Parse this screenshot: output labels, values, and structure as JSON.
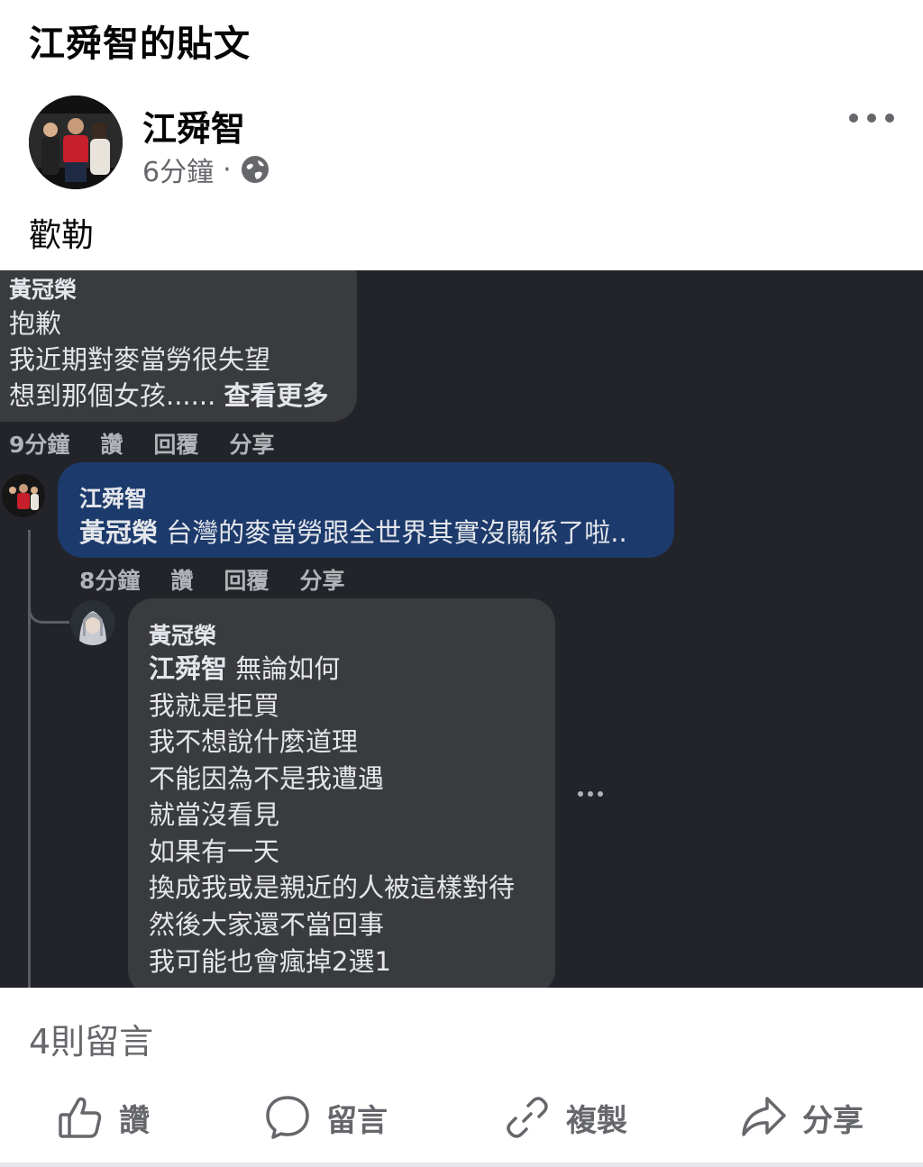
{
  "page": {
    "title": "江舜智的貼文"
  },
  "post": {
    "author": "江舜智",
    "time": "6分鐘",
    "separator": "·",
    "audience_icon": "globe-icon",
    "more_icon": "more-dots-icon",
    "text": "歡勒"
  },
  "screenshot": {
    "comment1": {
      "author": "黃冠榮",
      "lines": [
        "抱歉",
        "我近期對麥當勞很失望"
      ],
      "last_line": "想到那個女孩......",
      "see_more": "查看更多",
      "time": "9分鐘",
      "like": "讚",
      "reply": "回覆",
      "share": "分享"
    },
    "comment2": {
      "author": "江舜智",
      "tag": "黃冠榮",
      "text": "台灣的麥當勞跟全世界其實沒關係了啦..",
      "time": "8分鐘",
      "like": "讚",
      "reply": "回覆",
      "share": "分享"
    },
    "comment3": {
      "author": "黃冠榮",
      "tag": "江舜智",
      "first_text": "無論如何",
      "lines": [
        "我就是拒買",
        "我不想說什麼道理",
        "不能因為不是我遭遇",
        "就當沒看見",
        "如果有一天",
        "換成我或是親近的人被這樣對待",
        "然後大家還不當回事",
        "我可能也會瘋掉2選1"
      ]
    }
  },
  "footer": {
    "comment_count": "4則留言",
    "actions": [
      {
        "label": "讚",
        "icon": "thumbs-up-icon"
      },
      {
        "label": "留言",
        "icon": "comment-bubble-icon"
      },
      {
        "label": "複製",
        "icon": "link-icon"
      },
      {
        "label": "分享",
        "icon": "share-arrow-icon"
      }
    ]
  },
  "colors": {
    "text": "#050505",
    "meta": "#65676b",
    "screenshot_bg": "#232429",
    "bubble_gray": "#3a3b3f",
    "bubble_blue": "#1c3a6b"
  }
}
